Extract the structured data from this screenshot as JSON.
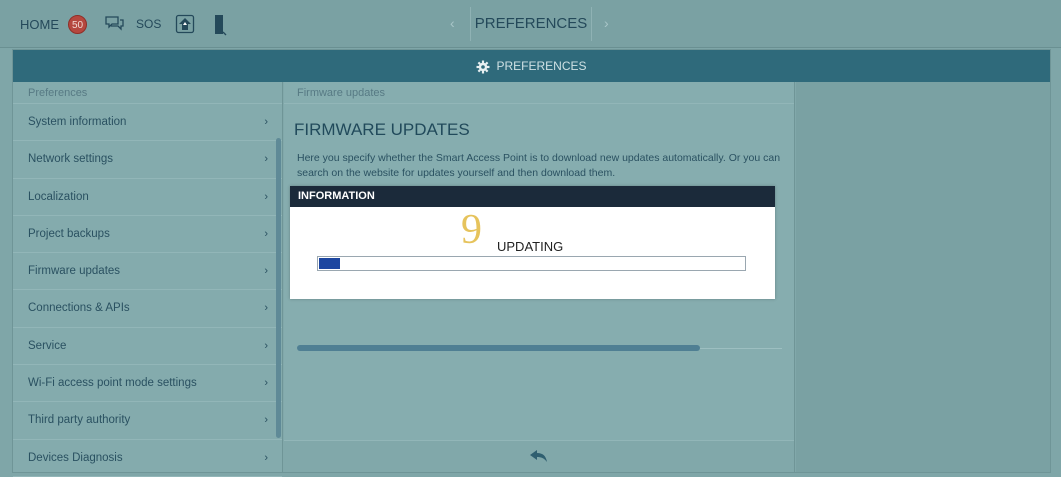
{
  "topbar": {
    "home_label": "HOME",
    "notification_count": "50",
    "sos_label": "SOS",
    "nav_prev": "‹",
    "title": "PREFERENCES",
    "nav_next": "›"
  },
  "header": {
    "title": "PREFERENCES"
  },
  "sidebar": {
    "heading": "Preferences",
    "items": [
      {
        "label": "System information"
      },
      {
        "label": "Network settings"
      },
      {
        "label": "Localization"
      },
      {
        "label": "Project backups"
      },
      {
        "label": "Firmware updates"
      },
      {
        "label": "Connections & APIs"
      },
      {
        "label": "Service"
      },
      {
        "label": "Wi-Fi access point mode settings"
      },
      {
        "label": "Third party authority"
      },
      {
        "label": "Devices Diagnosis"
      }
    ],
    "chevron": "›"
  },
  "content": {
    "breadcrumb": "Firmware updates",
    "title": "FIRMWARE UPDATES",
    "description": "Here you specify whether the Smart Access Point is to download new updates automatically. Or you can search on the website for updates yourself and then download them.",
    "progress_fraction": 0.83
  },
  "dialog": {
    "heading": "INFORMATION",
    "countdown": "9",
    "status": "UPDATING",
    "progress_fraction": 0.05
  },
  "colors": {
    "header_bg": "#2f6a7b",
    "dialog_head_bg": "#1b2a3a",
    "countdown": "#e6c35c",
    "progress_fill": "#1d46a0",
    "badge": "#b5473e"
  }
}
